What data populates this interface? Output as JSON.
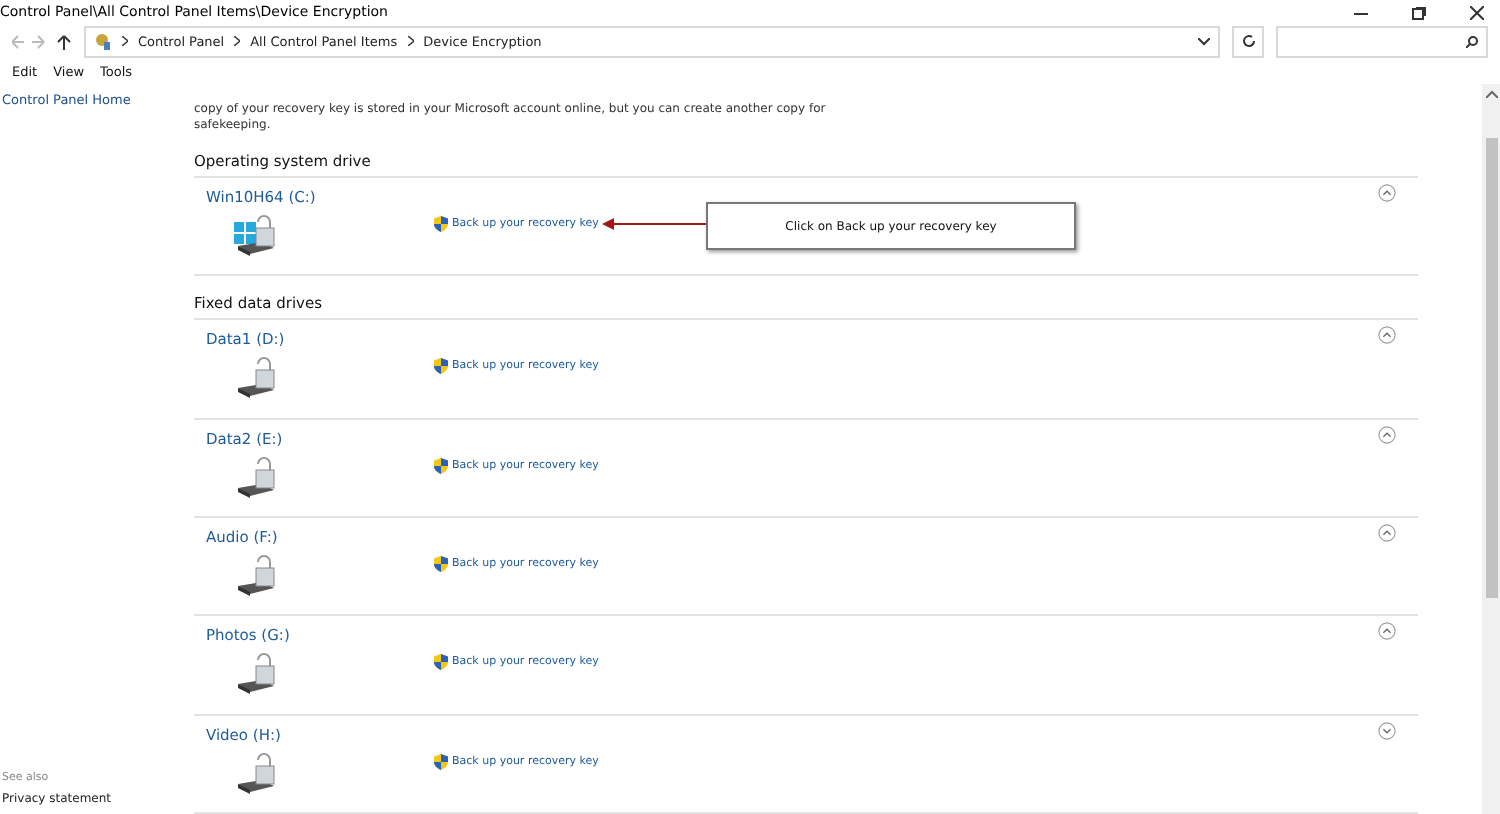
{
  "window": {
    "title": "Control Panel\\All Control Panel Items\\Device Encryption"
  },
  "address_bar": {
    "crumbs": [
      "Control Panel",
      "All Control Panel Items",
      "Device Encryption"
    ]
  },
  "menu": [
    "Edit",
    "View",
    "Tools"
  ],
  "sidebar": {
    "home": "Control Panel Home",
    "see_also": "See also",
    "links": [
      "Privacy statement"
    ]
  },
  "intro": [
    "copy of your recovery key is stored in your Microsoft account online, but you can create another copy for",
    "safekeeping."
  ],
  "sections": [
    {
      "title": "Operating system drive",
      "drives": [
        {
          "name": "Win10H64 (C:)",
          "kind": "os",
          "link": "Back up your recovery key",
          "expanded": true
        }
      ]
    },
    {
      "title": "Fixed data drives",
      "drives": [
        {
          "name": "Data1 (D:)",
          "kind": "data",
          "link": "Back up your recovery key",
          "expanded": true
        },
        {
          "name": "Data2 (E:)",
          "kind": "data",
          "link": "Back up your recovery key",
          "expanded": true
        },
        {
          "name": "Audio (F:)",
          "kind": "data",
          "link": "Back up your recovery key",
          "expanded": true
        },
        {
          "name": "Photos (G:)",
          "kind": "data",
          "link": "Back up your recovery key",
          "expanded": true
        },
        {
          "name": "Video (H:)",
          "kind": "data",
          "link": "Back up your recovery key",
          "expanded": false
        }
      ]
    }
  ],
  "callout": {
    "text": "Click on Back up your recovery key"
  }
}
